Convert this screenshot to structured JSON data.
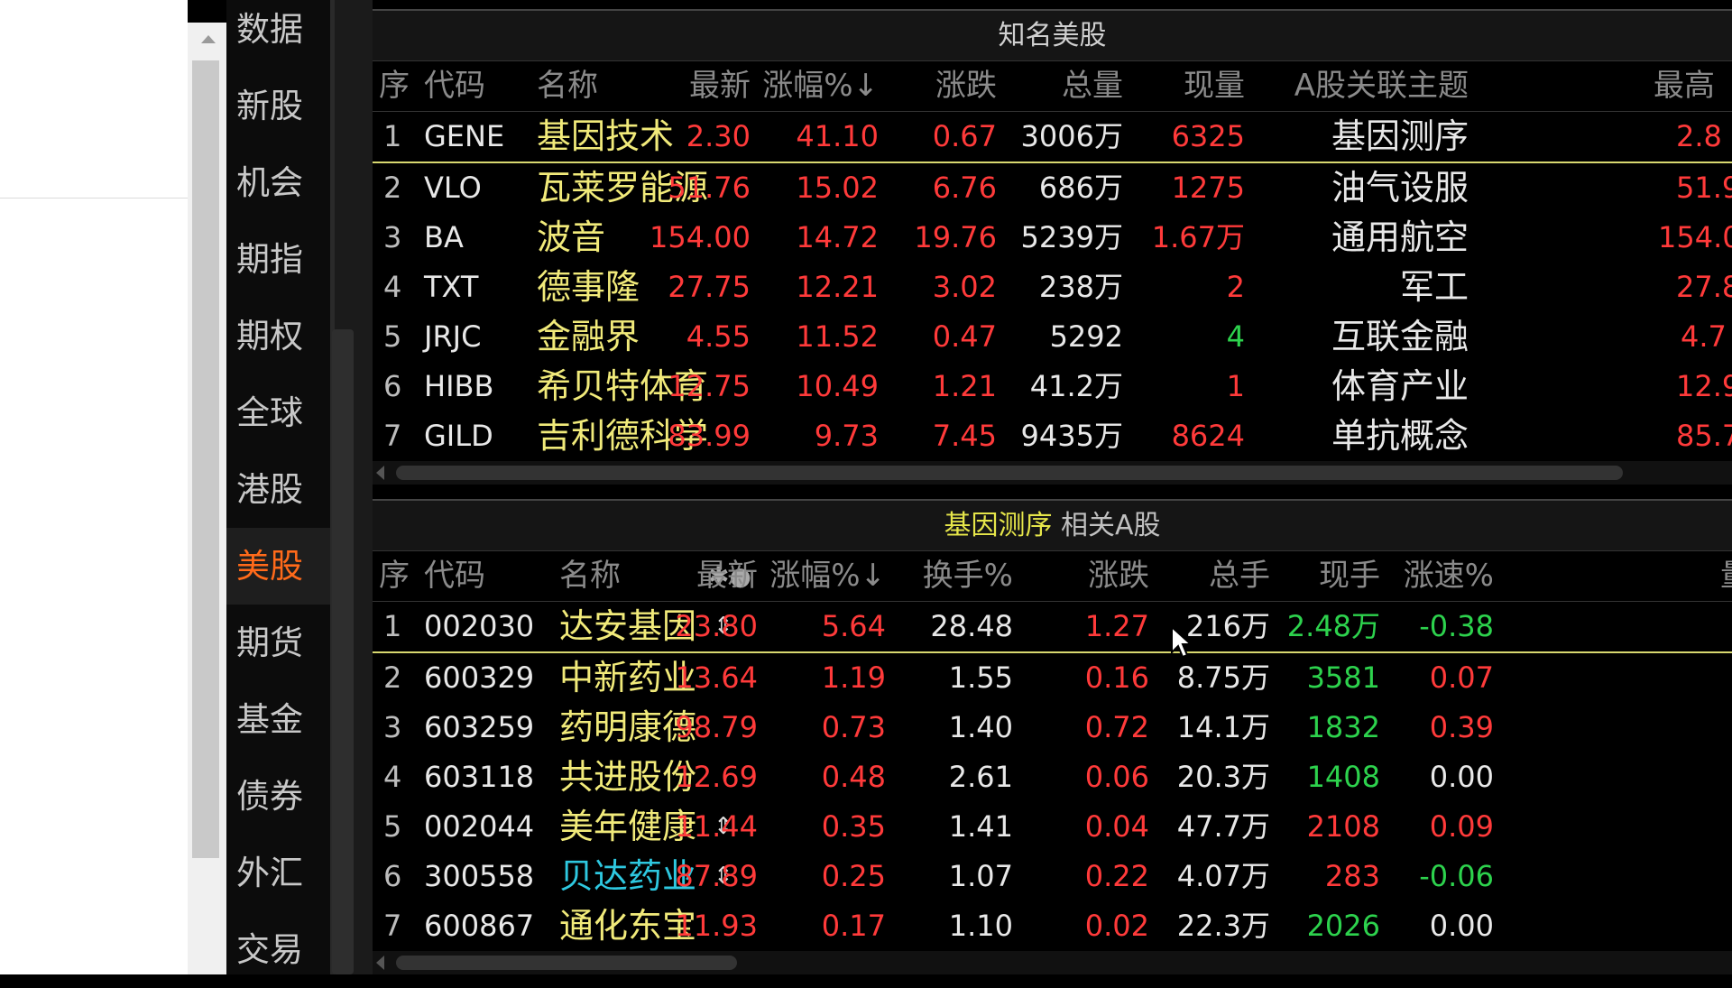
{
  "left_nav": [
    {
      "label": "数据",
      "active": false
    },
    {
      "label": "新股",
      "active": false
    },
    {
      "label": "机会",
      "active": false
    },
    {
      "label": "期指",
      "active": false
    },
    {
      "label": "期权",
      "active": false
    },
    {
      "label": "全球",
      "active": false
    },
    {
      "label": "港股",
      "active": false
    },
    {
      "label": "美股",
      "active": true
    },
    {
      "label": "期货",
      "active": false
    },
    {
      "label": "基金",
      "active": false
    },
    {
      "label": "债券",
      "active": false
    },
    {
      "label": "外汇",
      "active": false
    },
    {
      "label": "交易",
      "active": false
    }
  ],
  "us_panel": {
    "title": "知名美股",
    "headers": {
      "seq": "序",
      "code": "代码",
      "name": "名称",
      "latest": "最新",
      "change_pct": "涨幅%↓",
      "change": "涨跌",
      "volume": "总量",
      "current_vol": "现量",
      "theme": "A股关联主题",
      "extra": "最高"
    },
    "rows": [
      {
        "seq": "1",
        "code": "GENE",
        "name": "基因技术",
        "latest": "2.30",
        "change_pct": "41.10",
        "change": "0.67",
        "volume": "3006万",
        "current_vol": "6325",
        "theme": "基因测序",
        "extra": "2.8"
      },
      {
        "seq": "2",
        "code": "VLO",
        "name": "瓦莱罗能源",
        "latest": "51.76",
        "change_pct": "15.02",
        "change": "6.76",
        "volume": "686万",
        "current_vol": "1275",
        "theme": "油气设服",
        "extra": "51.9"
      },
      {
        "seq": "3",
        "code": "BA",
        "name": "波音",
        "latest": "154.00",
        "change_pct": "14.72",
        "change": "19.76",
        "volume": "5239万",
        "current_vol": "1.67万",
        "theme": "通用航空",
        "extra": "154.0"
      },
      {
        "seq": "4",
        "code": "TXT",
        "name": "德事隆",
        "latest": "27.75",
        "change_pct": "12.21",
        "change": "3.02",
        "volume": "238万",
        "current_vol": "2",
        "theme": "军工",
        "extra": "27.8"
      },
      {
        "seq": "5",
        "code": "JRJC",
        "name": "金融界",
        "latest": "4.55",
        "change_pct": "11.52",
        "change": "0.47",
        "volume": "5292",
        "current_vol": "4",
        "theme": "互联金融",
        "extra": "4.7"
      },
      {
        "seq": "6",
        "code": "HIBB",
        "name": "希贝特体育",
        "latest": "12.75",
        "change_pct": "10.49",
        "change": "1.21",
        "volume": "41.2万",
        "current_vol": "1",
        "theme": "体育产业",
        "extra": "12.9"
      },
      {
        "seq": "7",
        "code": "GILD",
        "name": "吉利德科学",
        "latest": "83.99",
        "change_pct": "9.73",
        "change": "7.45",
        "volume": "9435万",
        "current_vol": "8624",
        "theme": "单抗概念",
        "extra": "85.7"
      }
    ]
  },
  "a_panel": {
    "title_theme": "基因测序",
    "title_suffix": " 相关A股",
    "headers": {
      "seq": "序",
      "code": "代码",
      "name": "名称",
      "icons": "✱●",
      "latest": "最新",
      "change_pct": "涨幅%↓",
      "turnover": "换手%",
      "change": "涨跌",
      "total_hands": "总手",
      "current_hands": "现手",
      "speed": "涨速%",
      "extra": "量"
    },
    "rows": [
      {
        "seq": "1",
        "code": "002030",
        "name": "达安基因",
        "mark": "⇕",
        "cyan": false,
        "latest": "23.80",
        "change_pct": "5.64",
        "turnover": "28.48",
        "change": "1.27",
        "total_hands": "216万",
        "current_hands": "2.48万",
        "hands_color": "green",
        "speed": "-0.38",
        "speed_color": "green"
      },
      {
        "seq": "2",
        "code": "600329",
        "name": "中新药业",
        "mark": "",
        "cyan": false,
        "latest": "13.64",
        "change_pct": "1.19",
        "turnover": "1.55",
        "change": "0.16",
        "total_hands": "8.75万",
        "current_hands": "3581",
        "hands_color": "green",
        "speed": "0.07",
        "speed_color": "red"
      },
      {
        "seq": "3",
        "code": "603259",
        "name": "药明康德",
        "mark": "",
        "cyan": false,
        "latest": "98.79",
        "change_pct": "0.73",
        "turnover": "1.40",
        "change": "0.72",
        "total_hands": "14.1万",
        "current_hands": "1832",
        "hands_color": "green",
        "speed": "0.39",
        "speed_color": "red"
      },
      {
        "seq": "4",
        "code": "603118",
        "name": "共进股份",
        "mark": "",
        "cyan": false,
        "latest": "12.69",
        "change_pct": "0.48",
        "turnover": "2.61",
        "change": "0.06",
        "total_hands": "20.3万",
        "current_hands": "1408",
        "hands_color": "green",
        "speed": "0.00",
        "speed_color": "white"
      },
      {
        "seq": "5",
        "code": "002044",
        "name": "美年健康",
        "mark": "⇕",
        "cyan": false,
        "latest": "11.44",
        "change_pct": "0.35",
        "turnover": "1.41",
        "change": "0.04",
        "total_hands": "47.7万",
        "current_hands": "2108",
        "hands_color": "red",
        "speed": "0.09",
        "speed_color": "red"
      },
      {
        "seq": "6",
        "code": "300558",
        "name": "贝达药业",
        "mark": "⇕",
        "cyan": true,
        "latest": "87.89",
        "change_pct": "0.25",
        "turnover": "1.07",
        "change": "0.22",
        "total_hands": "4.07万",
        "current_hands": "283",
        "hands_color": "red",
        "speed": "-0.06",
        "speed_color": "green"
      },
      {
        "seq": "7",
        "code": "600867",
        "name": "通化东宝",
        "mark": "",
        "cyan": false,
        "latest": "11.93",
        "change_pct": "0.17",
        "turnover": "1.10",
        "change": "0.02",
        "total_hands": "22.3万",
        "current_hands": "2026",
        "hands_color": "green",
        "speed": "0.00",
        "speed_color": "white"
      }
    ]
  }
}
